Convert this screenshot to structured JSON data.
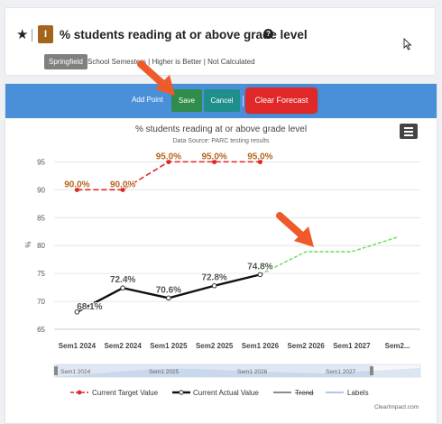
{
  "header": {
    "title": "% students reading at or above grade level",
    "badge": "I",
    "help_symbol": "?",
    "tag": "Springfield",
    "subline": "School Semesters | Higher is Better | Not Calculated"
  },
  "toolbar": {
    "add_point": "Add Point",
    "save": "Save",
    "cancel": "Cancel",
    "clear_forecast": "Clear Forecast"
  },
  "colors": {
    "toolbar": "#4a90d9",
    "target": "#e02828",
    "actual": "#111111",
    "forecast": "#66dd55",
    "target_label": "#b5651d"
  },
  "chart_data": {
    "type": "line",
    "title": "% students reading at or above grade level",
    "subtitle": "Data Source: PARC testing results",
    "ylabel": "%",
    "ylim": [
      65,
      97
    ],
    "yticks": [
      65,
      70,
      75,
      80,
      85,
      90,
      95
    ],
    "categories": [
      "Sem1 2024",
      "Sem2 2024",
      "Sem1 2025",
      "Sem2 2025",
      "Sem1 2026",
      "Sem2 2026",
      "Sem1 2027",
      "Sem2..."
    ],
    "series": [
      {
        "name": "Current Target Value",
        "values": [
          90.0,
          90.0,
          95.0,
          95.0,
          95.0
        ],
        "labels": [
          "90.0%",
          "90.0%",
          "95.0%",
          "95.0%",
          "95.0%"
        ]
      },
      {
        "name": "Current Actual Value",
        "values": [
          68.1,
          72.4,
          70.6,
          72.8,
          74.8
        ],
        "labels": [
          "68.1%",
          "72.4%",
          "70.6%",
          "72.8%",
          "74.8%"
        ]
      },
      {
        "name": "Forecast",
        "values": [
          null,
          null,
          null,
          null,
          74.8,
          78.9,
          78.9,
          81.5
        ]
      }
    ],
    "legend": [
      "Current Target Value",
      "Current Actual Value",
      "Trend",
      "Labels"
    ],
    "legend_position": "bottom",
    "navigator_labels": [
      "Sem1 2024",
      "Sem1 2025",
      "Sem1 2026",
      "Sem1 2027"
    ],
    "credit": "ClearImpact.com"
  }
}
